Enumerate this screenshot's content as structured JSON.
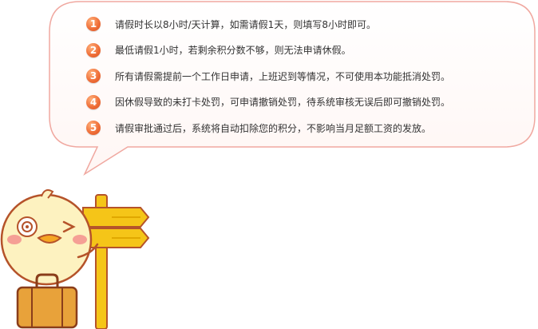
{
  "colors": {
    "bubble_border": "#f0a8a0",
    "bubble_fill": "#ffffff",
    "badge": "#f0703a",
    "text": "#333333",
    "sign": "#f5c518",
    "sign_border": "#b5532a",
    "suitcase": "#e8a23a"
  },
  "rules": [
    {
      "num": "1",
      "text": "请假时长以8小时/天计算，如需请假1天，则填写8小时即可。"
    },
    {
      "num": "2",
      "text": "最低请假1小时，若剩余积分数不够，则无法申请休假。"
    },
    {
      "num": "3",
      "text": "所有请假需提前一个工作日申请，上班迟到等情况，不可使用本功能抵消处罚。"
    },
    {
      "num": "4",
      "text": "因休假导致的未打卡处罚，可申请撤销处罚，待系统审核无误后即可撤销处罚。"
    },
    {
      "num": "5",
      "text": "请假审批通过后，系统将自动扣除您的积分，不影响当月足额工资的发放。"
    }
  ],
  "icons": {
    "mascot": "duck-mascot-with-signpost-and-suitcase"
  }
}
